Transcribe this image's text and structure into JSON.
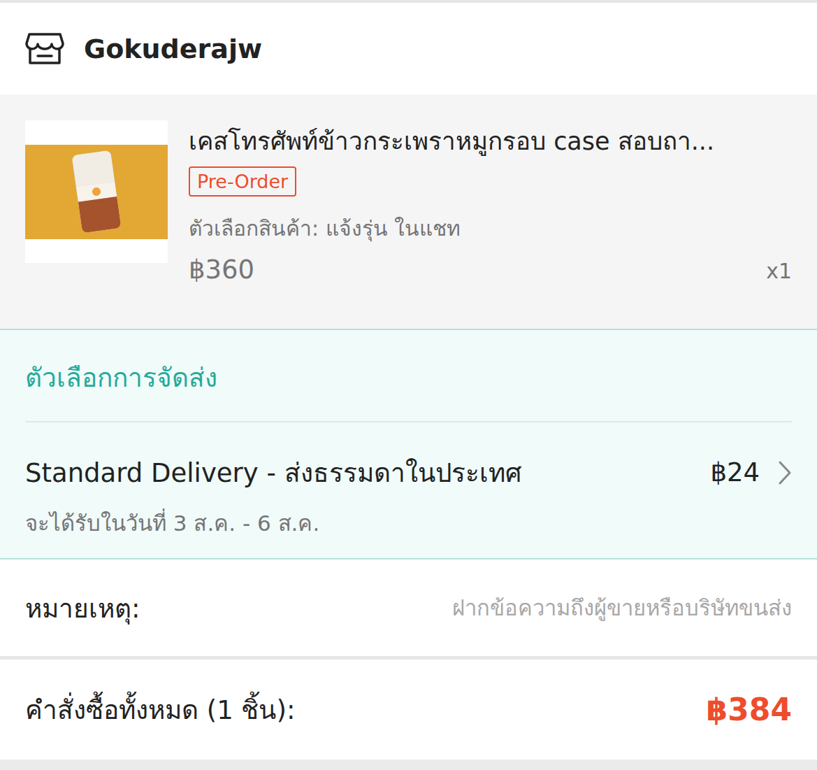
{
  "shop": {
    "name": "Gokuderajw"
  },
  "product": {
    "title": "เคสโทรศัพท์ข้าวกระเพราหมูกรอบ case สอบถา...",
    "badge": "Pre-Order",
    "variation": "ตัวเลือกสินค้า: แจ้งรุ่น ในแชท",
    "price": "฿360",
    "quantity": "x1"
  },
  "shipping": {
    "heading": "ตัวเลือกการจัดส่ง",
    "method": "Standard Delivery - ส่งธรรมดาในประเทศ",
    "fee": "฿24",
    "eta": "จะได้รับในวันที่ 3 ส.ค. - 6 ส.ค."
  },
  "note": {
    "label": "หมายเหตุ:",
    "placeholder": "ฝากข้อความถึงผู้ขายหรือบริษัทขนส่ง"
  },
  "total": {
    "label": "คำสั่งซื้อทั้งหมด (1 ชิ้น):",
    "amount": "฿384"
  }
}
